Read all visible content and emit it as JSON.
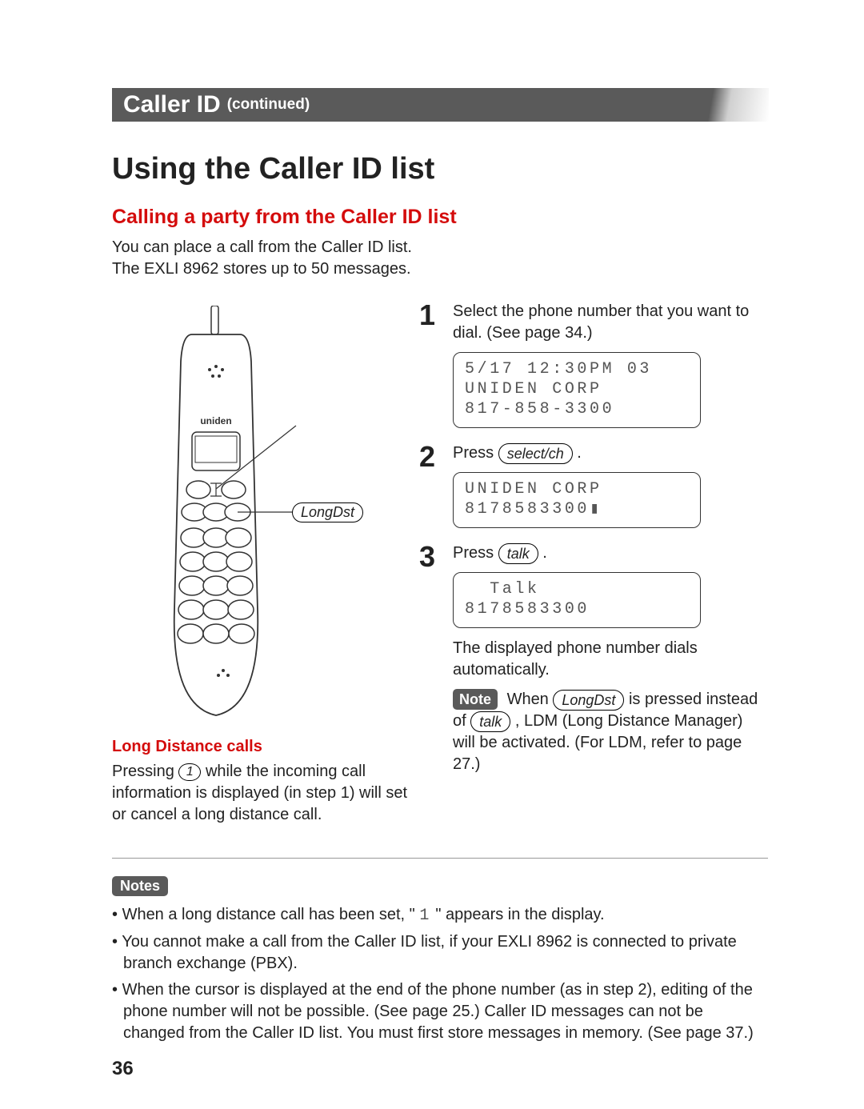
{
  "banner": {
    "title": "Caller ID",
    "suffix": "(continued)"
  },
  "page_title": "Using the Caller ID list",
  "subhead": "Calling a party from the Caller ID list",
  "intro_line1": "You can place a call from the Caller ID list.",
  "intro_line2": "The EXLI 8962 stores up to 50 messages.",
  "callout_label": "LongDst",
  "steps": {
    "s1": {
      "num": "1",
      "text": "Select the phone number that you want to dial. (See page 34.)",
      "lcd": {
        "l1": "5/17 12:30PM 03",
        "l2": "UNIDEN CORP",
        "l3": "817-858-3300"
      }
    },
    "s2": {
      "num": "2",
      "text_before": "Press ",
      "button": "select/ch",
      "text_after": " .",
      "lcd": {
        "l1": "UNIDEN CORP",
        "l2": "8178583300▮",
        "l3": ""
      }
    },
    "s3": {
      "num": "3",
      "text_before": "Press ",
      "button": "talk",
      "text_after": " .",
      "lcd": {
        "l1": "  Talk",
        "l2": "8178583300",
        "l3": ""
      },
      "tail": "The displayed phone number dials automatically.",
      "note_label": "Note",
      "note_a": " When ",
      "note_btn1": "LongDst",
      "note_b": " is pressed instead of ",
      "note_btn2": "talk",
      "note_c": " , LDM (Long Distance Manager) will be activated. (For LDM, refer to page 27.)"
    }
  },
  "long_distance": {
    "heading": "Long Distance calls",
    "text_a": "Pressing ",
    "key": "1",
    "text_b": " while the incoming call information is displayed (in step 1) will set or cancel a long distance call."
  },
  "notes_label": "Notes",
  "notes": {
    "n1_a": "When a long distance call has been set, \"",
    "n1_glyph": "1",
    "n1_b": "\" appears in the display.",
    "n2": "You cannot make a call from the Caller ID list, if your EXLI 8962 is connected to private branch exchange (PBX).",
    "n3": "When the cursor is displayed at the end of the phone number (as in step 2), editing of the phone number will not be possible. (See page 25.) Caller ID messages can not be changed from the Caller ID list. You must first store messages in memory. (See page 37.)"
  },
  "page_number": "36"
}
